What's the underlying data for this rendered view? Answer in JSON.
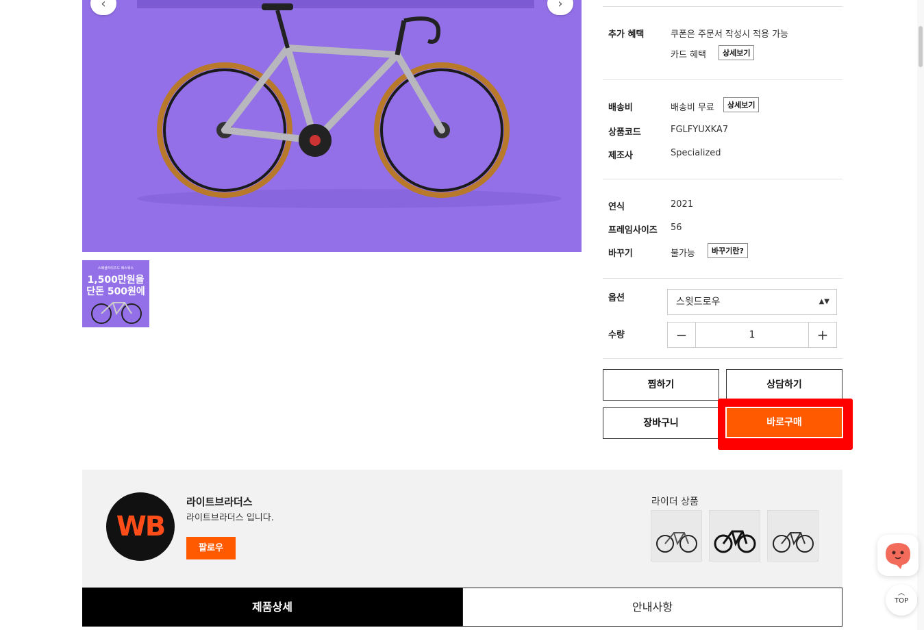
{
  "product": {
    "thumbnail": {
      "line1": "스페셜라이즈드 에스웍스",
      "line2": "1,500만원을",
      "line3": "단돈 500원에"
    },
    "benefits": {
      "label": "추가 혜택",
      "coupon_text": "쿠폰은 주문서 작성시 적용 가능",
      "card_text": "카드 혜택",
      "card_detail_button": "상세보기"
    },
    "shipping": {
      "label": "배송비",
      "value": "배송비 무료",
      "detail_button": "상세보기"
    },
    "code": {
      "label": "상품코드",
      "value": "FGLFYUXKA7"
    },
    "maker": {
      "label": "제조사",
      "value": "Specialized"
    },
    "year": {
      "label": "연식",
      "value": "2021"
    },
    "frame_size": {
      "label": "프레임사이즈",
      "value": "56"
    },
    "exchange": {
      "label": "바꾸기",
      "value": "불가능",
      "info_button": "바꾸기란?"
    },
    "option": {
      "label": "옵션",
      "selected": "스윗드로우"
    },
    "quantity": {
      "label": "수량",
      "value": "1",
      "minus": "−",
      "plus": "+"
    },
    "buttons": {
      "wishlist": "찜하기",
      "consult": "상담하기",
      "cart": "장바구니",
      "buy_now": "바로구매"
    }
  },
  "seller": {
    "logo_text": "WB",
    "name": "라이트브라더스",
    "description": "라이트브라더스 입니다.",
    "follow_button": "팔로우",
    "rider_products_title": "라이더 상품"
  },
  "tabs": {
    "detail": "제품상세",
    "notice": "안내사항"
  },
  "floating": {
    "top_label": "TOP"
  },
  "colors": {
    "accent": "#ff5a00",
    "highlight": "#ff0000",
    "image_bg": "#9370e8"
  }
}
